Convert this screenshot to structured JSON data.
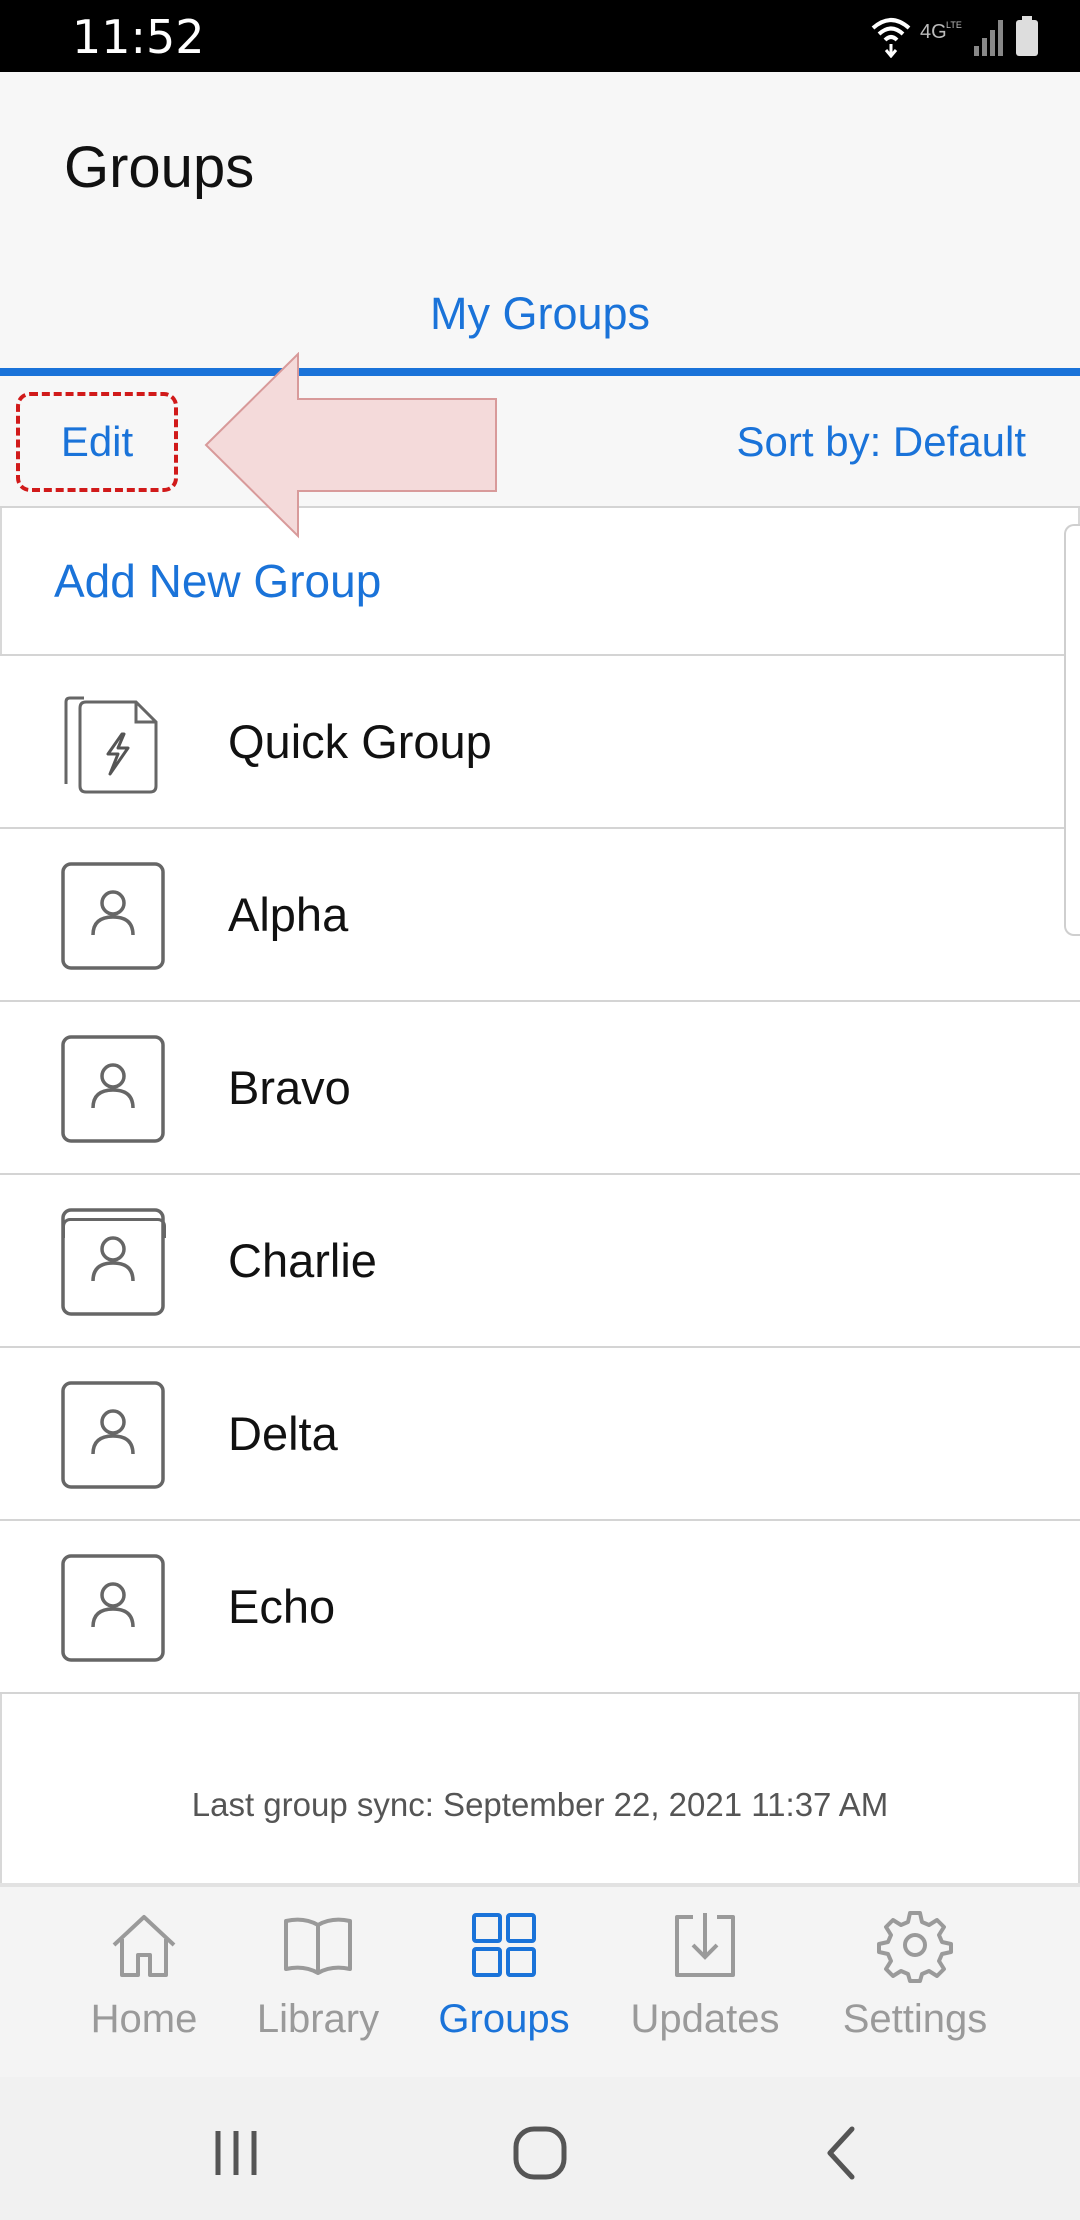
{
  "status_bar": {
    "time": "11:52",
    "icons": [
      "wifi-icon",
      "4g-lte-icon",
      "signal-icon",
      "battery-icon"
    ]
  },
  "header": {
    "title": "Groups"
  },
  "tabs": [
    {
      "label": "My Groups",
      "active": true
    }
  ],
  "toolbar": {
    "edit_label": "Edit",
    "sort_label": "Sort by: Default"
  },
  "list": {
    "add_label": "Add New Group",
    "items": [
      {
        "name": "Quick Group",
        "icon": "quick-group-icon"
      },
      {
        "name": "Alpha",
        "icon": "person-icon"
      },
      {
        "name": "Bravo",
        "icon": "person-icon"
      },
      {
        "name": "Charlie",
        "icon": "person-icon"
      },
      {
        "name": "Delta",
        "icon": "person-icon"
      },
      {
        "name": "Echo",
        "icon": "person-icon"
      }
    ]
  },
  "sync": {
    "text": "Last group sync: September 22, 2021 11:37 AM"
  },
  "bottom_nav": {
    "items": [
      {
        "label": "Home",
        "icon": "home-icon",
        "active": false
      },
      {
        "label": "Library",
        "icon": "book-icon",
        "active": false
      },
      {
        "label": "Groups",
        "icon": "grid-icon",
        "active": true
      },
      {
        "label": "Updates",
        "icon": "download-icon",
        "active": false
      },
      {
        "label": "Settings",
        "icon": "gear-icon",
        "active": false
      }
    ]
  },
  "android_nav": {
    "buttons": [
      "recents-icon",
      "home-circle-icon",
      "back-icon"
    ]
  },
  "colors": {
    "accent": "#1a73d9",
    "annotation_highlight": "#d11a1a",
    "annotation_arrow_fill": "#f4dada",
    "annotation_arrow_stroke": "#d89a9a"
  }
}
